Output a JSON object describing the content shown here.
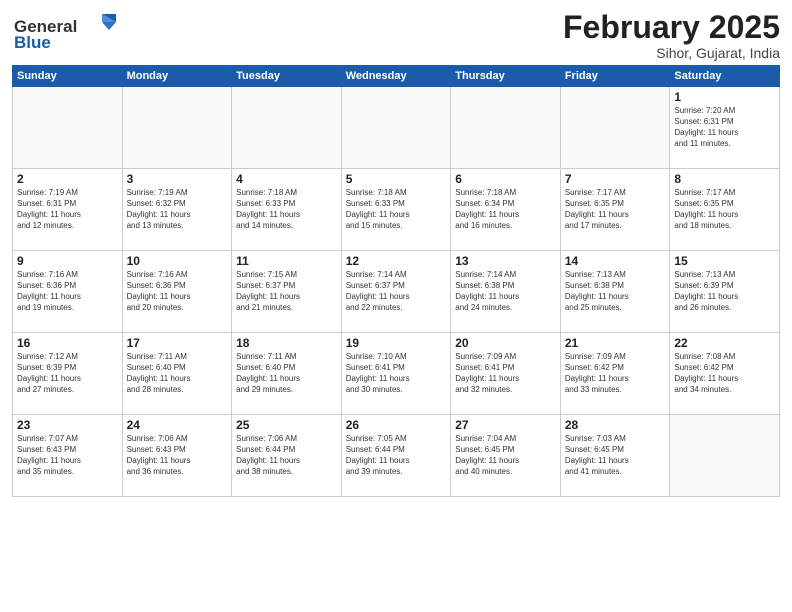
{
  "logo": {
    "text_general": "General",
    "text_blue": "Blue"
  },
  "title": "February 2025",
  "subtitle": "Sihor, Gujarat, India",
  "weekdays": [
    "Sunday",
    "Monday",
    "Tuesday",
    "Wednesday",
    "Thursday",
    "Friday",
    "Saturday"
  ],
  "weeks": [
    [
      {
        "day": "",
        "info": ""
      },
      {
        "day": "",
        "info": ""
      },
      {
        "day": "",
        "info": ""
      },
      {
        "day": "",
        "info": ""
      },
      {
        "day": "",
        "info": ""
      },
      {
        "day": "",
        "info": ""
      },
      {
        "day": "1",
        "info": "Sunrise: 7:20 AM\nSunset: 6:31 PM\nDaylight: 11 hours\nand 11 minutes."
      }
    ],
    [
      {
        "day": "2",
        "info": "Sunrise: 7:19 AM\nSunset: 6:31 PM\nDaylight: 11 hours\nand 12 minutes."
      },
      {
        "day": "3",
        "info": "Sunrise: 7:19 AM\nSunset: 6:32 PM\nDaylight: 11 hours\nand 13 minutes."
      },
      {
        "day": "4",
        "info": "Sunrise: 7:18 AM\nSunset: 6:33 PM\nDaylight: 11 hours\nand 14 minutes."
      },
      {
        "day": "5",
        "info": "Sunrise: 7:18 AM\nSunset: 6:33 PM\nDaylight: 11 hours\nand 15 minutes."
      },
      {
        "day": "6",
        "info": "Sunrise: 7:18 AM\nSunset: 6:34 PM\nDaylight: 11 hours\nand 16 minutes."
      },
      {
        "day": "7",
        "info": "Sunrise: 7:17 AM\nSunset: 6:35 PM\nDaylight: 11 hours\nand 17 minutes."
      },
      {
        "day": "8",
        "info": "Sunrise: 7:17 AM\nSunset: 6:35 PM\nDaylight: 11 hours\nand 18 minutes."
      }
    ],
    [
      {
        "day": "9",
        "info": "Sunrise: 7:16 AM\nSunset: 6:36 PM\nDaylight: 11 hours\nand 19 minutes."
      },
      {
        "day": "10",
        "info": "Sunrise: 7:16 AM\nSunset: 6:36 PM\nDaylight: 11 hours\nand 20 minutes."
      },
      {
        "day": "11",
        "info": "Sunrise: 7:15 AM\nSunset: 6:37 PM\nDaylight: 11 hours\nand 21 minutes."
      },
      {
        "day": "12",
        "info": "Sunrise: 7:14 AM\nSunset: 6:37 PM\nDaylight: 11 hours\nand 22 minutes."
      },
      {
        "day": "13",
        "info": "Sunrise: 7:14 AM\nSunset: 6:38 PM\nDaylight: 11 hours\nand 24 minutes."
      },
      {
        "day": "14",
        "info": "Sunrise: 7:13 AM\nSunset: 6:38 PM\nDaylight: 11 hours\nand 25 minutes."
      },
      {
        "day": "15",
        "info": "Sunrise: 7:13 AM\nSunset: 6:39 PM\nDaylight: 11 hours\nand 26 minutes."
      }
    ],
    [
      {
        "day": "16",
        "info": "Sunrise: 7:12 AM\nSunset: 6:39 PM\nDaylight: 11 hours\nand 27 minutes."
      },
      {
        "day": "17",
        "info": "Sunrise: 7:11 AM\nSunset: 6:40 PM\nDaylight: 11 hours\nand 28 minutes."
      },
      {
        "day": "18",
        "info": "Sunrise: 7:11 AM\nSunset: 6:40 PM\nDaylight: 11 hours\nand 29 minutes."
      },
      {
        "day": "19",
        "info": "Sunrise: 7:10 AM\nSunset: 6:41 PM\nDaylight: 11 hours\nand 30 minutes."
      },
      {
        "day": "20",
        "info": "Sunrise: 7:09 AM\nSunset: 6:41 PM\nDaylight: 11 hours\nand 32 minutes."
      },
      {
        "day": "21",
        "info": "Sunrise: 7:09 AM\nSunset: 6:42 PM\nDaylight: 11 hours\nand 33 minutes."
      },
      {
        "day": "22",
        "info": "Sunrise: 7:08 AM\nSunset: 6:42 PM\nDaylight: 11 hours\nand 34 minutes."
      }
    ],
    [
      {
        "day": "23",
        "info": "Sunrise: 7:07 AM\nSunset: 6:43 PM\nDaylight: 11 hours\nand 35 minutes."
      },
      {
        "day": "24",
        "info": "Sunrise: 7:06 AM\nSunset: 6:43 PM\nDaylight: 11 hours\nand 36 minutes."
      },
      {
        "day": "25",
        "info": "Sunrise: 7:06 AM\nSunset: 6:44 PM\nDaylight: 11 hours\nand 38 minutes."
      },
      {
        "day": "26",
        "info": "Sunrise: 7:05 AM\nSunset: 6:44 PM\nDaylight: 11 hours\nand 39 minutes."
      },
      {
        "day": "27",
        "info": "Sunrise: 7:04 AM\nSunset: 6:45 PM\nDaylight: 11 hours\nand 40 minutes."
      },
      {
        "day": "28",
        "info": "Sunrise: 7:03 AM\nSunset: 6:45 PM\nDaylight: 11 hours\nand 41 minutes."
      },
      {
        "day": "",
        "info": ""
      }
    ]
  ]
}
